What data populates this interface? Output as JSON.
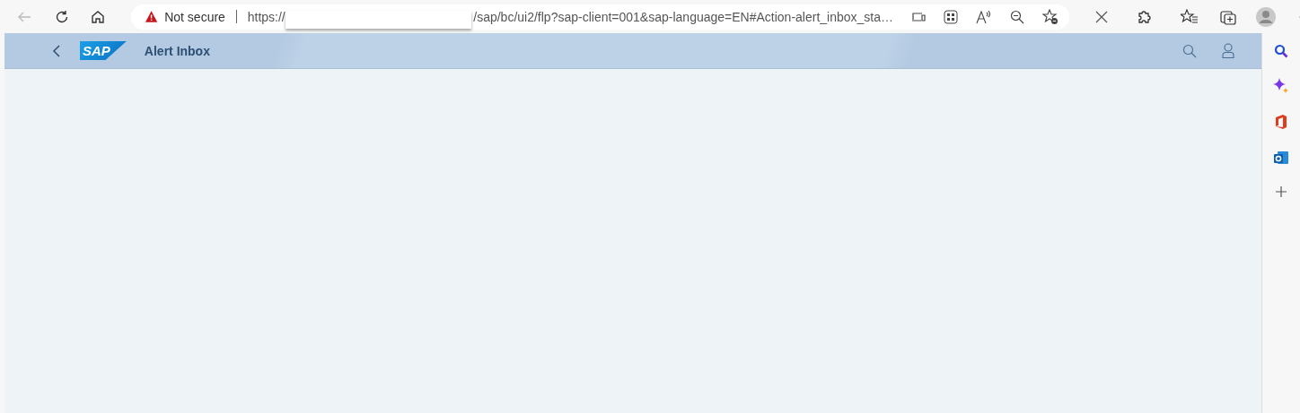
{
  "browser": {
    "security_label": "Not secure",
    "url_start": "https://",
    "url_end": "/sap/bc/ui2/flp?sap-client=001&sap-language=EN#Action-alert_inbox_sta…"
  },
  "shell": {
    "logo": "SAP",
    "title": "Alert Inbox"
  }
}
